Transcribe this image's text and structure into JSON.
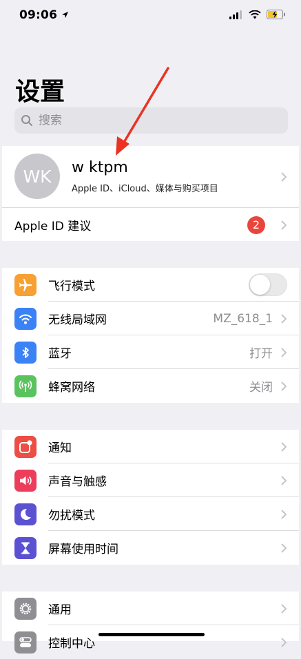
{
  "status_bar": {
    "time": "09:06"
  },
  "page_title": "设置",
  "search": {
    "placeholder": "搜索"
  },
  "profile": {
    "initials": "WK",
    "name": "w ktpm",
    "subtitle": "Apple ID、iCloud、媒体与购买项目"
  },
  "apple_id_suggestion": {
    "label": "Apple ID 建议",
    "badge": "2"
  },
  "connectivity": [
    {
      "label": "飞行模式",
      "value": "",
      "icon": "airplane-icon",
      "color": "#f7a033",
      "toggle": false
    },
    {
      "label": "无线局域网",
      "value": "MZ_618_1",
      "icon": "wifi-icon",
      "color": "#3b82f6"
    },
    {
      "label": "蓝牙",
      "value": "打开",
      "icon": "bluetooth-icon",
      "color": "#3b82f6"
    },
    {
      "label": "蜂窝网络",
      "value": "关闭",
      "icon": "cellular-icon",
      "color": "#5bc35d"
    }
  ],
  "notifications_group": [
    {
      "label": "通知",
      "icon": "notifications-icon",
      "color": "#ec4d44"
    },
    {
      "label": "声音与触感",
      "icon": "sound-icon",
      "color": "#ec3e5b"
    },
    {
      "label": "勿扰模式",
      "icon": "moon-icon",
      "color": "#5b52d1"
    },
    {
      "label": "屏幕使用时间",
      "icon": "hourglass-icon",
      "color": "#5b52d1"
    }
  ],
  "general_group": [
    {
      "label": "通用",
      "icon": "gear-icon",
      "color": "#8e8e93"
    },
    {
      "label": "控制中心",
      "icon": "control-center-icon",
      "color": "#8e8e93"
    }
  ]
}
